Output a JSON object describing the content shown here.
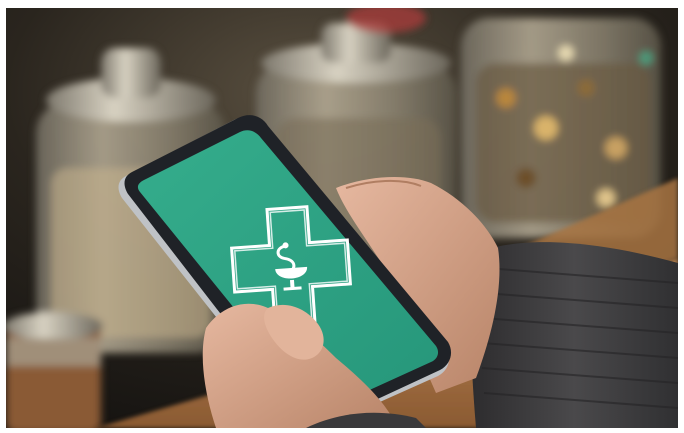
{
  "photo": {
    "subject": "hand-holding-smartphone",
    "screen_icon": "pharmacy-cross-icon",
    "colors": {
      "screen": "#2fa585",
      "screen_dark": "#24906f",
      "phone_frame": "#1f2227",
      "phone_silver": "#b9bcc0",
      "sleeve": "#3c3b3d",
      "skin": "#d8a487",
      "counter": "#b07a4c",
      "jar_glass": "#8d8576",
      "background": "#1a1815"
    }
  }
}
